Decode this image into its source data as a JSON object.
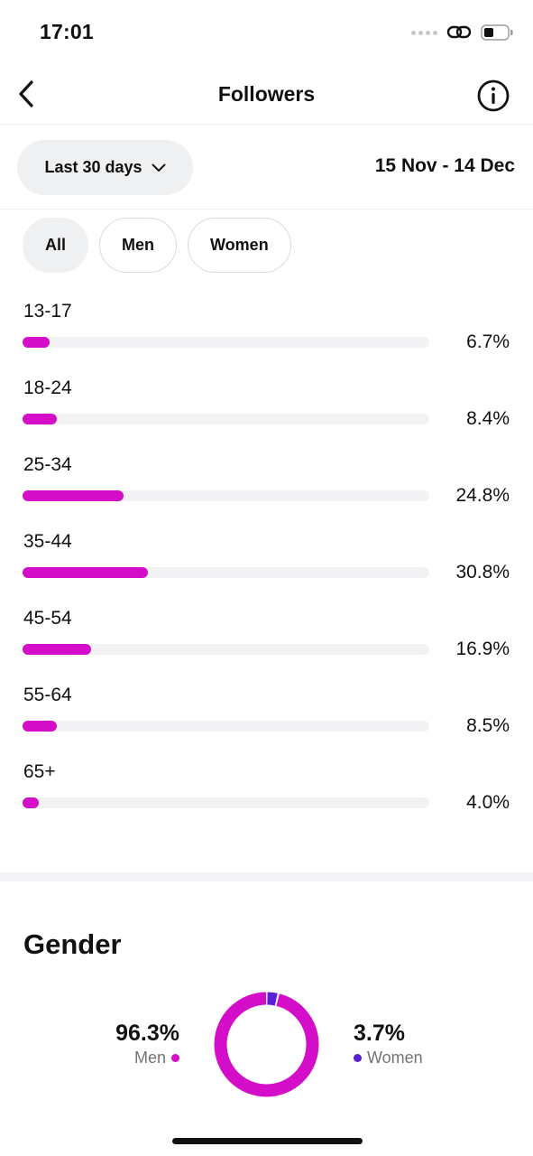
{
  "status_bar": {
    "time": "17:01",
    "icons": [
      "signal-dots-icon",
      "link-icon",
      "battery-icon"
    ]
  },
  "header": {
    "title": "Followers",
    "back_icon": "chevron-left-icon",
    "info_icon": "info-icon"
  },
  "range": {
    "label": "Last 30 days",
    "dates": "15 Nov - 14 Dec"
  },
  "filters": [
    {
      "label": "All",
      "selected": true
    },
    {
      "label": "Men",
      "selected": false
    },
    {
      "label": "Women",
      "selected": false
    }
  ],
  "age_groups": [
    {
      "label": "13-17",
      "percent_text": "6.7%",
      "value": 6.7
    },
    {
      "label": "18-24",
      "percent_text": "8.4%",
      "value": 8.4
    },
    {
      "label": "25-34",
      "percent_text": "24.8%",
      "value": 24.8
    },
    {
      "label": "35-44",
      "percent_text": "30.8%",
      "value": 30.8
    },
    {
      "label": "45-54",
      "percent_text": "16.9%",
      "value": 16.9
    },
    {
      "label": "55-64",
      "percent_text": "8.5%",
      "value": 8.5
    },
    {
      "label": "65+",
      "percent_text": "4.0%",
      "value": 4.0
    }
  ],
  "bar_scale_max": 100,
  "gender": {
    "title": "Gender",
    "men": {
      "percent_text": "96.3%",
      "label": "Men",
      "value": 96.3
    },
    "women": {
      "percent_text": "3.7%",
      "label": "Women",
      "value": 3.7
    }
  },
  "colors": {
    "accent_magenta": "#d40ec8",
    "accent_purple": "#5b1fd6",
    "track": "#f2f2f4"
  }
}
